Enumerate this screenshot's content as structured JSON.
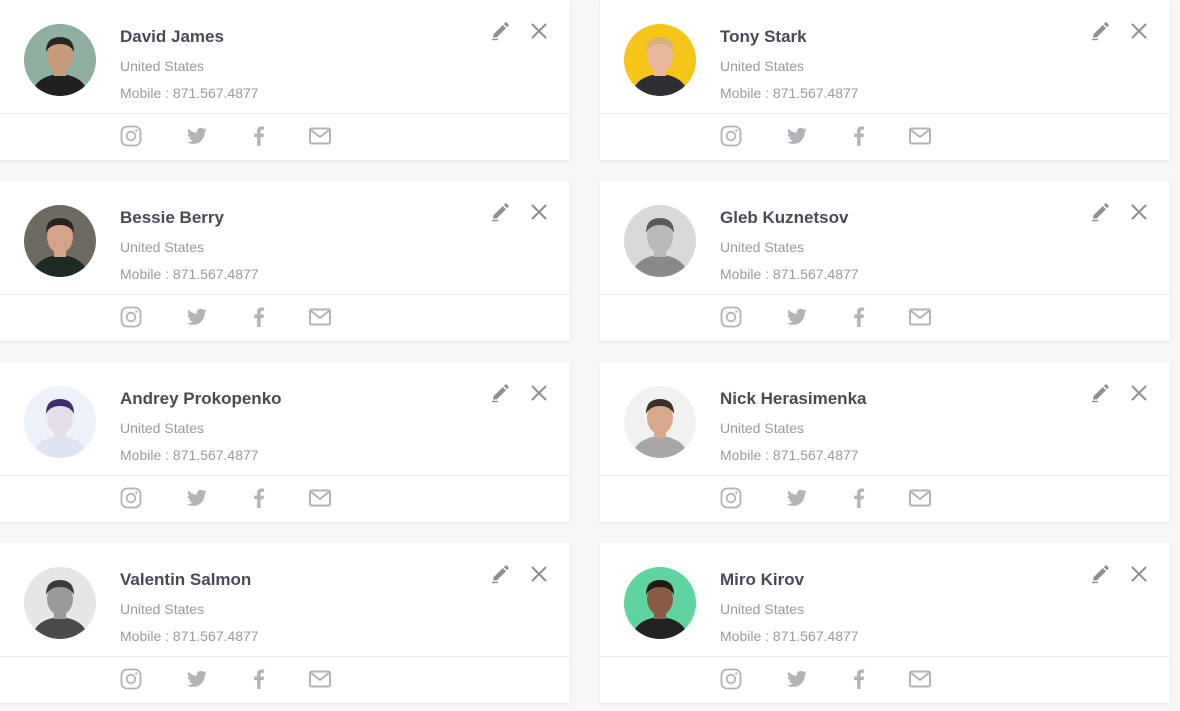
{
  "contacts": [
    {
      "name": "David James",
      "country": "United States",
      "mobile": "Mobile : 871.567.4877",
      "avatar_bg": "#8fb0a0",
      "skin": "#c89a7a",
      "hair": "#2b2522",
      "shirt": "#1f1f22"
    },
    {
      "name": "Tony Stark",
      "country": "United States",
      "mobile": "Mobile : 871.567.4877",
      "avatar_bg": "#f5c518",
      "skin": "#e8b99c",
      "hair": "#d9b07a",
      "shirt": "#2f2f33"
    },
    {
      "name": "Bessie Berry",
      "country": "United States",
      "mobile": "Mobile : 871.567.4877",
      "avatar_bg": "#6d6a62",
      "skin": "#d3a488",
      "hair": "#2a2420",
      "shirt": "#1e2a24"
    },
    {
      "name": "Gleb Kuznetsov",
      "country": "United States",
      "mobile": "Mobile : 871.567.4877",
      "avatar_bg": "#d9d9d9",
      "skin": "#b9b9b9",
      "hair": "#5a5a5a",
      "shirt": "#8a8a8a"
    },
    {
      "name": "Andrey Prokopenko",
      "country": "United States",
      "mobile": "Mobile : 871.567.4877",
      "avatar_bg": "#eef0fa",
      "skin": "#e6ddea",
      "hair": "#3b2f6b",
      "shirt": "#dfe4f2"
    },
    {
      "name": "Nick Herasimenka",
      "country": "United States",
      "mobile": "Mobile : 871.567.4877",
      "avatar_bg": "#f1f1ef",
      "skin": "#d7a98a",
      "hair": "#3a2e28",
      "shirt": "#a7a7a7"
    },
    {
      "name": "Valentin Salmon",
      "country": "United States",
      "mobile": "Mobile : 871.567.4877",
      "avatar_bg": "#e6e6e6",
      "skin": "#9a9a9a",
      "hair": "#3a3a3a",
      "shirt": "#4a4a4a"
    },
    {
      "name": "Miro Kirov",
      "country": "United States",
      "mobile": "Mobile : 871.567.4877",
      "avatar_bg": "#5fd3a0",
      "skin": "#8a5c45",
      "hair": "#1f1a18",
      "shirt": "#222222"
    }
  ],
  "icons": {
    "edit": "pencil-icon",
    "close": "close-icon",
    "social": [
      "instagram-icon",
      "twitter-icon",
      "facebook-icon",
      "mail-icon"
    ]
  },
  "colors": {
    "name": "#4a4a55",
    "muted": "#9a9aa2",
    "icon": "#b3b3b8",
    "action_icon": "#8e8e96"
  }
}
